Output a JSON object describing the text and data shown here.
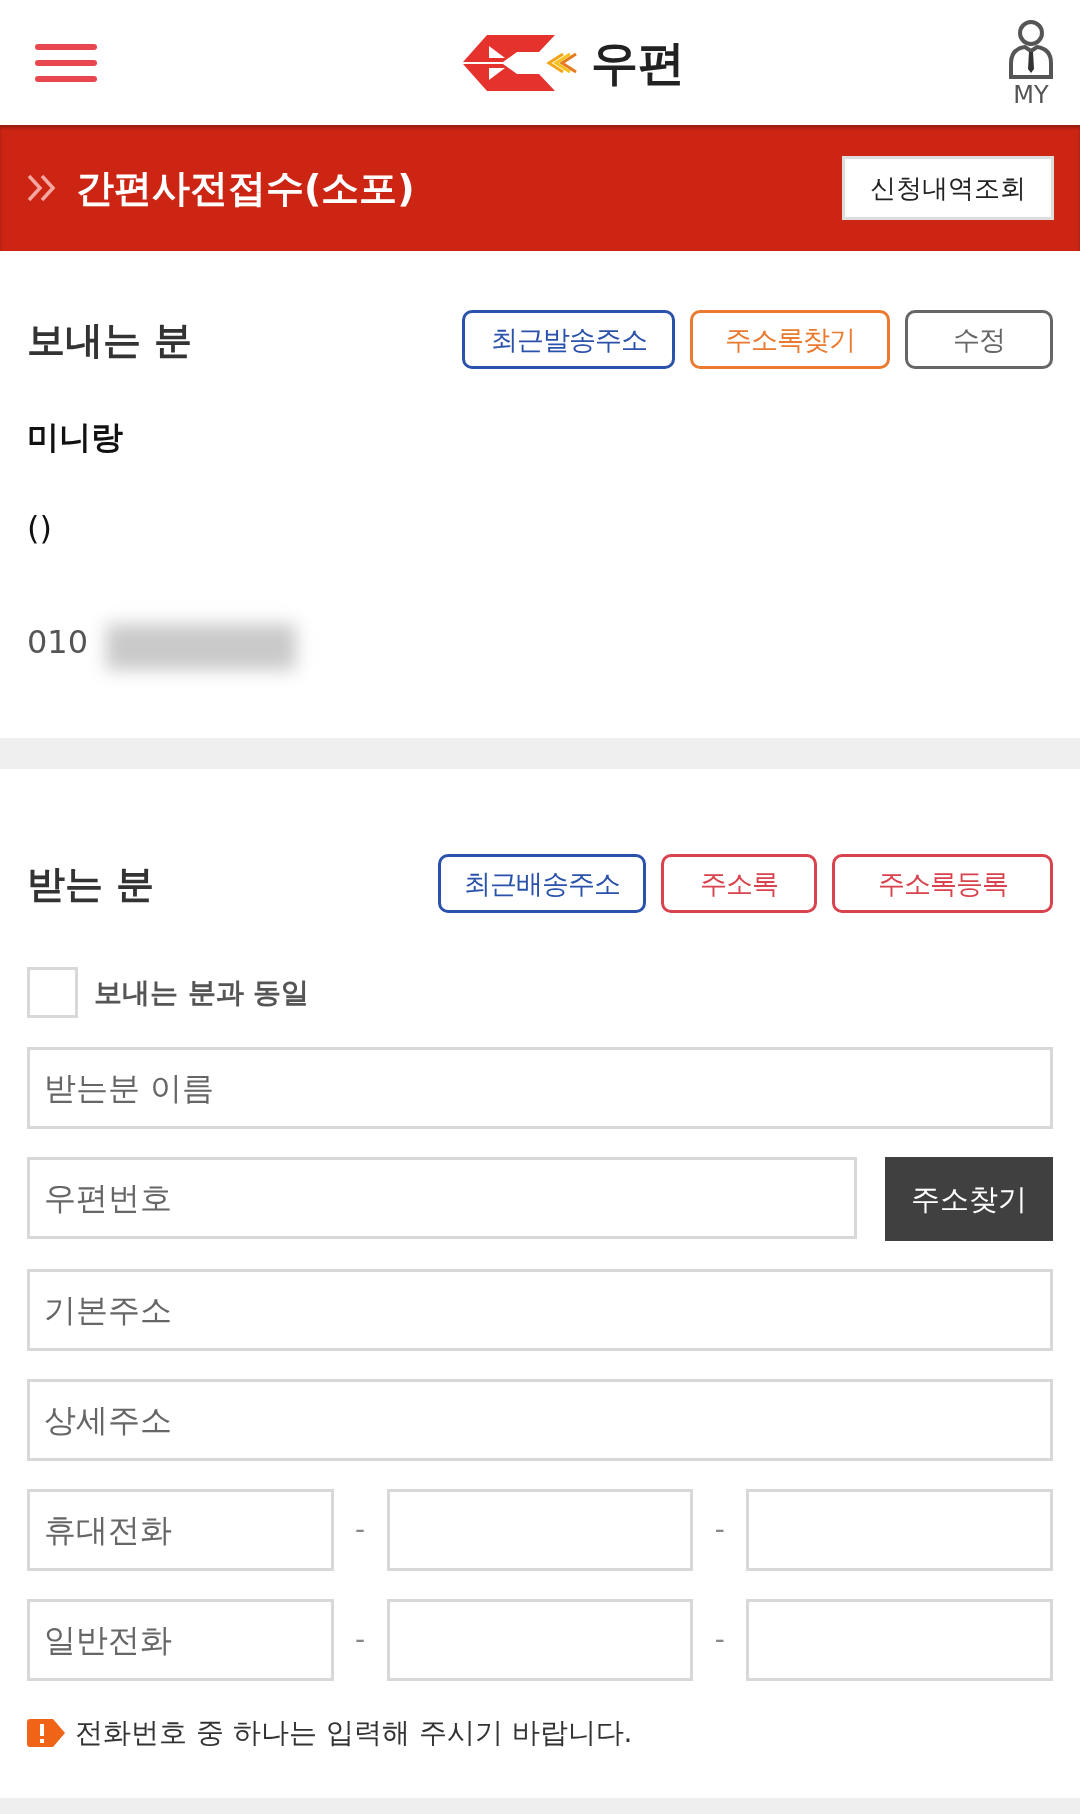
{
  "header": {
    "logo_text": "우편",
    "my_label": "MY"
  },
  "title_bar": {
    "title": "간편사전접수(소포)",
    "button": "신청내역조회"
  },
  "sender": {
    "heading": "보내는 분",
    "buttons": [
      {
        "label": "최근발송주소",
        "color": "#2b52aa"
      },
      {
        "label": "주소록찾기",
        "color": "#ea7a2f"
      },
      {
        "label": "수정",
        "color": "#666666"
      }
    ],
    "name": "미니랑",
    "address": "()",
    "phone": "010"
  },
  "receiver": {
    "heading": "받는 분",
    "buttons": [
      {
        "label": "최근배송주소",
        "color": "#2b52aa"
      },
      {
        "label": "주소록",
        "color": "#d8434d"
      },
      {
        "label": "주소록등록",
        "color": "#d8434d"
      }
    ],
    "same_as_sender": {
      "label": "보내는 분과 동일",
      "checked": false
    },
    "fields": [
      {
        "kind": "text",
        "placeholder": "받는분 이름"
      },
      {
        "kind": "postcode",
        "placeholder": "우편번호",
        "button": "주소찾기"
      },
      {
        "kind": "text",
        "placeholder": "기본주소"
      },
      {
        "kind": "text",
        "placeholder": "상세주소"
      },
      {
        "kind": "phone",
        "placeholder": "휴대전화",
        "separators": [
          "-",
          "-"
        ]
      },
      {
        "kind": "phone",
        "placeholder": "일반전화",
        "separators": [
          "-",
          "-"
        ]
      }
    ],
    "notice": "전화번호 중 하나는 입력해 주시기 바랍니다."
  }
}
